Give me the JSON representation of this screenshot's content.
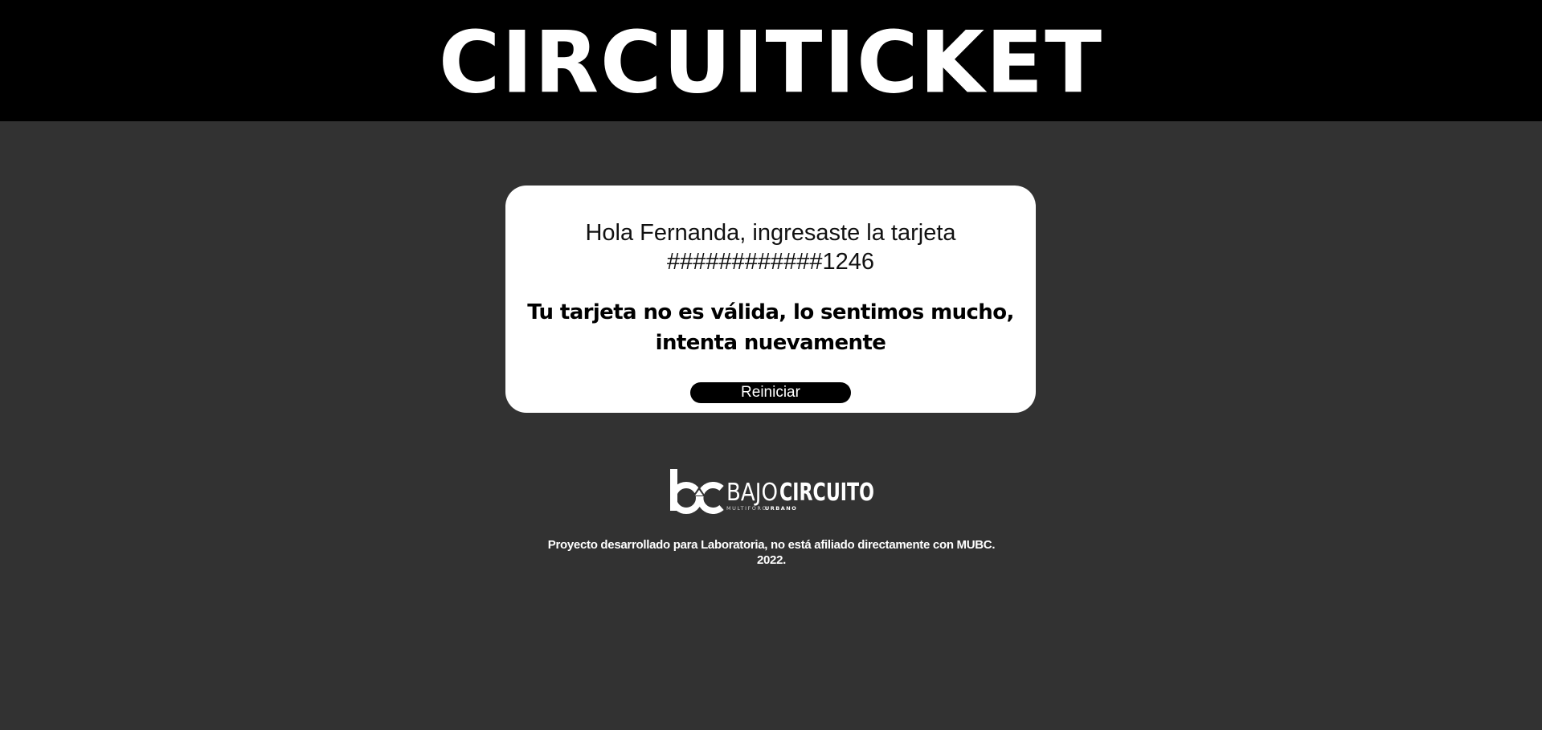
{
  "header": {
    "title": "CIRCUITICKET"
  },
  "card": {
    "greeting_line1": "Hola Fernanda, ingresaste la tarjeta",
    "greeting_line2": "############1246",
    "error_message": "Tu tarjeta no es válida, lo sentimos mucho, intenta nuevamente",
    "reset_label": "Reiniciar"
  },
  "logo": {
    "mark": "bc",
    "name_light": "BAJO",
    "name_bold": "CIRCUITO",
    "tagline_light": "MULTIFORO",
    "tagline_bold": "URBANO"
  },
  "footer": {
    "line1": "Proyecto desarrollado para Laboratoria, no está afiliado directamente con MUBC.",
    "line2": "2022."
  },
  "colors": {
    "header_bg": "#000000",
    "page_bg": "#323232",
    "card_bg": "#ffffff",
    "button_bg": "#000000"
  }
}
